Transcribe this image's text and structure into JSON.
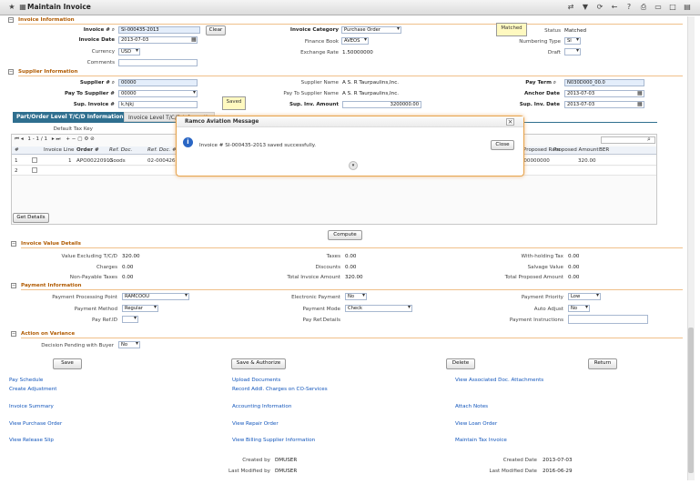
{
  "window": {
    "title": "Maintain Invoice"
  },
  "sections": {
    "invoice_info": "Invoice Information",
    "supplier_info": "Supplier Information",
    "value_details": "Invoice Value Details",
    "payment_info": "Payment Information",
    "action_variance": "Action on Variance"
  },
  "invoice": {
    "invoice_no_label": "Invoice #",
    "invoice_no": "SI-000435-2013",
    "clear_label": "Clear",
    "invoice_date_label": "Invoice Date",
    "invoice_date": "2013-07-03",
    "currency_label": "Currency",
    "currency": "USD",
    "comments_label": "Comments",
    "comments": "",
    "category_label": "Invoice Category",
    "category": "Purchase Order",
    "finance_book_label": "Finance Book",
    "finance_book": "AVEOS",
    "exchange_rate_label": "Exchange Rate",
    "exchange_rate": "1.50000000",
    "status_label": "Status",
    "status": "Matched",
    "numbering_type_label": "Numbering Type",
    "numbering_type": "SI",
    "draft_label": "Draft",
    "draft": ""
  },
  "callouts": {
    "matched": "Matched",
    "saved": "Saved"
  },
  "supplier": {
    "supplier_no_label": "Supplier #",
    "supplier_no": "00000",
    "pay_to_label": "Pay To Supplier #",
    "pay_to": "00000",
    "sup_invoice_label": "Sup. Invoice #",
    "sup_invoice": "k,hjkj",
    "supplier_name_label": "Supplier Name",
    "supplier_name": "A S. R Taurpaulins,Inc.",
    "pay_to_name_label": "Pay To Supplier Name",
    "pay_to_name": "A S. R Taurpaulins,Inc.",
    "sup_inv_amount_label": "Sup. Inv. Amount",
    "sup_inv_amount": "3200000.00",
    "pay_term_label": "Pay Term",
    "pay_term": "N030D000_00.0",
    "anchor_date_label": "Anchor Date",
    "anchor_date": "2013-07-03",
    "sup_inv_date_label": "Sup. Inv. Date",
    "sup_inv_date": "2013-07-03"
  },
  "tabs": [
    {
      "label": "Part/Order Level T/C/D Information"
    },
    {
      "label": "Invoice Level T/C/D Information"
    }
  ],
  "grid": {
    "default_tax_key_label": "Default Tax Key",
    "pager": "1 - 1 / 1",
    "headers": [
      "#",
      "",
      "Invoice Line",
      "Order #",
      "Ref. Doc.",
      "Ref. Doc. #"
    ],
    "right_headers": [
      "Proposed Rate",
      "Proposed Amount",
      "BER"
    ],
    "rows": [
      {
        "num": "1",
        "line": "1",
        "order": "APO00220913",
        "ref_doc": "Goods",
        "ref_doc_no": "02-000426-2",
        "rate": "1.00000000",
        "amount": "320.00"
      },
      {
        "num": "2",
        "line": "",
        "order": "",
        "ref_doc": "",
        "ref_doc_no": "",
        "rate": "",
        "amount": ""
      }
    ],
    "get_details_label": "Get Details"
  },
  "dialog": {
    "title": "Ramco Aviation Message",
    "message": "Invoice # SI-000435-2013 saved successfully.",
    "close_label": "Close",
    "close_x": "×"
  },
  "compute_label": "Compute",
  "values": {
    "value_excl_label": "Value Excluding T/C/D",
    "value_excl": "320.00",
    "charges_label": "Charges",
    "charges": "0.00",
    "non_payable_label": "Non-Payable Taxes",
    "non_payable": "0.00",
    "taxes_label": "Taxes",
    "taxes": "0.00",
    "discounts_label": "Discounts",
    "discounts": "0.00",
    "total_invoice_label": "Total Invoice Amount",
    "total_invoice": "320.00",
    "withholding_label": "With-holding Tax",
    "withholding": "0.00",
    "salvage_label": "Salvage Value",
    "salvage": "0.00",
    "total_proposed_label": "Total Proposed Amount",
    "total_proposed": "0.00"
  },
  "payment": {
    "point_label": "Payment Processing Point",
    "point": "RAMCOOU",
    "method_label": "Payment Method",
    "method": "Regular",
    "pay_ref_label": "Pay Ref.ID",
    "pay_ref": "",
    "electronic_label": "Electronic Payment",
    "electronic": "No",
    "mode_label": "Payment Mode",
    "mode": "Check",
    "pay_ref_details_label": "Pay Ref.Details",
    "priority_label": "Payment Priority",
    "priority": "Low",
    "auto_adjust_label": "Auto Adjust",
    "auto_adjust": "No",
    "instructions_label": "Payment Instructions",
    "instructions": ""
  },
  "variance": {
    "decision_label": "Decision Pending with Buyer",
    "decision": "No"
  },
  "buttons": {
    "save": "Save",
    "save_authorize": "Save & Authorize",
    "delete": "Delete",
    "return": "Return"
  },
  "links": {
    "col1": [
      "Pay Schedule",
      "Create Adjustment",
      "Invoice Summary",
      "View Purchase Order",
      "View Release Slip"
    ],
    "col2": [
      "Upload Documents",
      "Record Addl. Charges on CO-Services",
      "Accounting Information",
      "View Repair Order",
      "View Billing Supplier Information"
    ],
    "col3": [
      "View Associated Doc. Attachments",
      "Attach Notes",
      "View Loan Order",
      "Maintain Tax Invoice"
    ]
  },
  "audit": {
    "created_by_label": "Created by",
    "created_by": "DMUSER",
    "modified_by_label": "Last Modified by",
    "modified_by": "DMUSER",
    "created_date_label": "Created Date",
    "created_date": "2013-07-03",
    "modified_date_label": "Last Modified Date",
    "modified_date": "2016-06-29"
  },
  "icons": [
    "star-icon",
    "grid-icon",
    "shuffle-icon",
    "filter-icon",
    "repeat-icon",
    "back-icon",
    "help-icon",
    "print-icon",
    "window-icon",
    "maximize-icon"
  ]
}
